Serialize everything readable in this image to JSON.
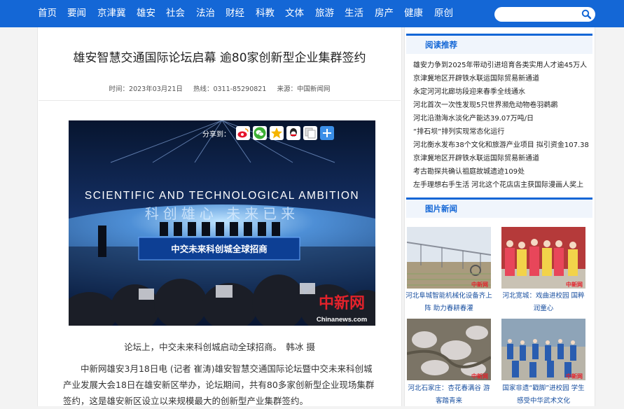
{
  "nav": {
    "items": [
      "首页",
      "要闻",
      "京津冀",
      "雄安",
      "社会",
      "法治",
      "财经",
      "科教",
      "文体",
      "旅游",
      "生活",
      "房产",
      "健康",
      "原创"
    ],
    "search_placeholder": ""
  },
  "article": {
    "title": "雄安智慧交通国际论坛启幕 逾80家创新型企业集群签约",
    "time_label": "时间：2023年03月21日",
    "hotline_label": "热线：0311-85290821",
    "source_label": "来源：中国新闻网",
    "share_label": "分享到：",
    "photo": {
      "banner_en": "SCIENTIFIC AND TECHNOLOGICAL AMBITION",
      "banner_cn": "科创雄心 未来已来",
      "stage_sign": "中交未来科创城全球招商",
      "watermark_cn": "中新网",
      "watermark_url": "Chinanews.com"
    },
    "caption": "论坛上，中交未来科创城启动全球招商。　韩冰 摄",
    "paragraph": "中新网雄安3月18日电 (记者 崔涛)雄安智慧交通国际论坛暨中交未来科创城产业发展大会18日在雄安新区举办，论坛期间，共有80多家创新型企业现场集群签约，这是雄安新区设立以来规模最大的创新型产业集群签约。"
  },
  "sidebar": {
    "reading_title": "阅读推荐",
    "reading_items": [
      "雄安力争到2025年带动引进培育各类实用人才逾45万人",
      "京津冀地区开辟铁水联运国际贸易新通道",
      "永定河河北廊坊段迎来春季全线通水",
      "河北首次一次性发现5只世界濒危动物卷羽鹈鹕",
      "河北沿渤海水淡化产能达39.07万吨/日",
      "“排石坝”排列实现常态化运行",
      "河北衡水发布38个文化和旅游产业项目 拟引资金107.38",
      "京津冀地区开辟铁水联运国际贸易新通道",
      "考古勘探共确认祖庭故城遗迹109处",
      "左手理想右手生活 河北这个花店店主获国际漫画人奖上"
    ],
    "photo_title": "图片新闻",
    "photos": [
      {
        "caption": "河北阜城智能机械化设备齐上阵 助力春耕春灌",
        "watermark": "中新网"
      },
      {
        "caption": "河北宽城：戏曲进校园 国粹润童心",
        "watermark": "中新网"
      },
      {
        "caption": "河北石家庄：杏花春满谷 游客踏青来",
        "watermark": "中新网"
      },
      {
        "caption": "国家非遗“戳脚”进校园 学生感受中华武术文化",
        "watermark": "中新网"
      }
    ]
  },
  "colors": {
    "brand_blue": "#1467d6",
    "nav_text": "#ffffff"
  },
  "icons": [
    "search-icon",
    "weibo-icon",
    "wechat-icon",
    "qzone-icon",
    "qq-icon",
    "copy-icon",
    "more-icon"
  ]
}
